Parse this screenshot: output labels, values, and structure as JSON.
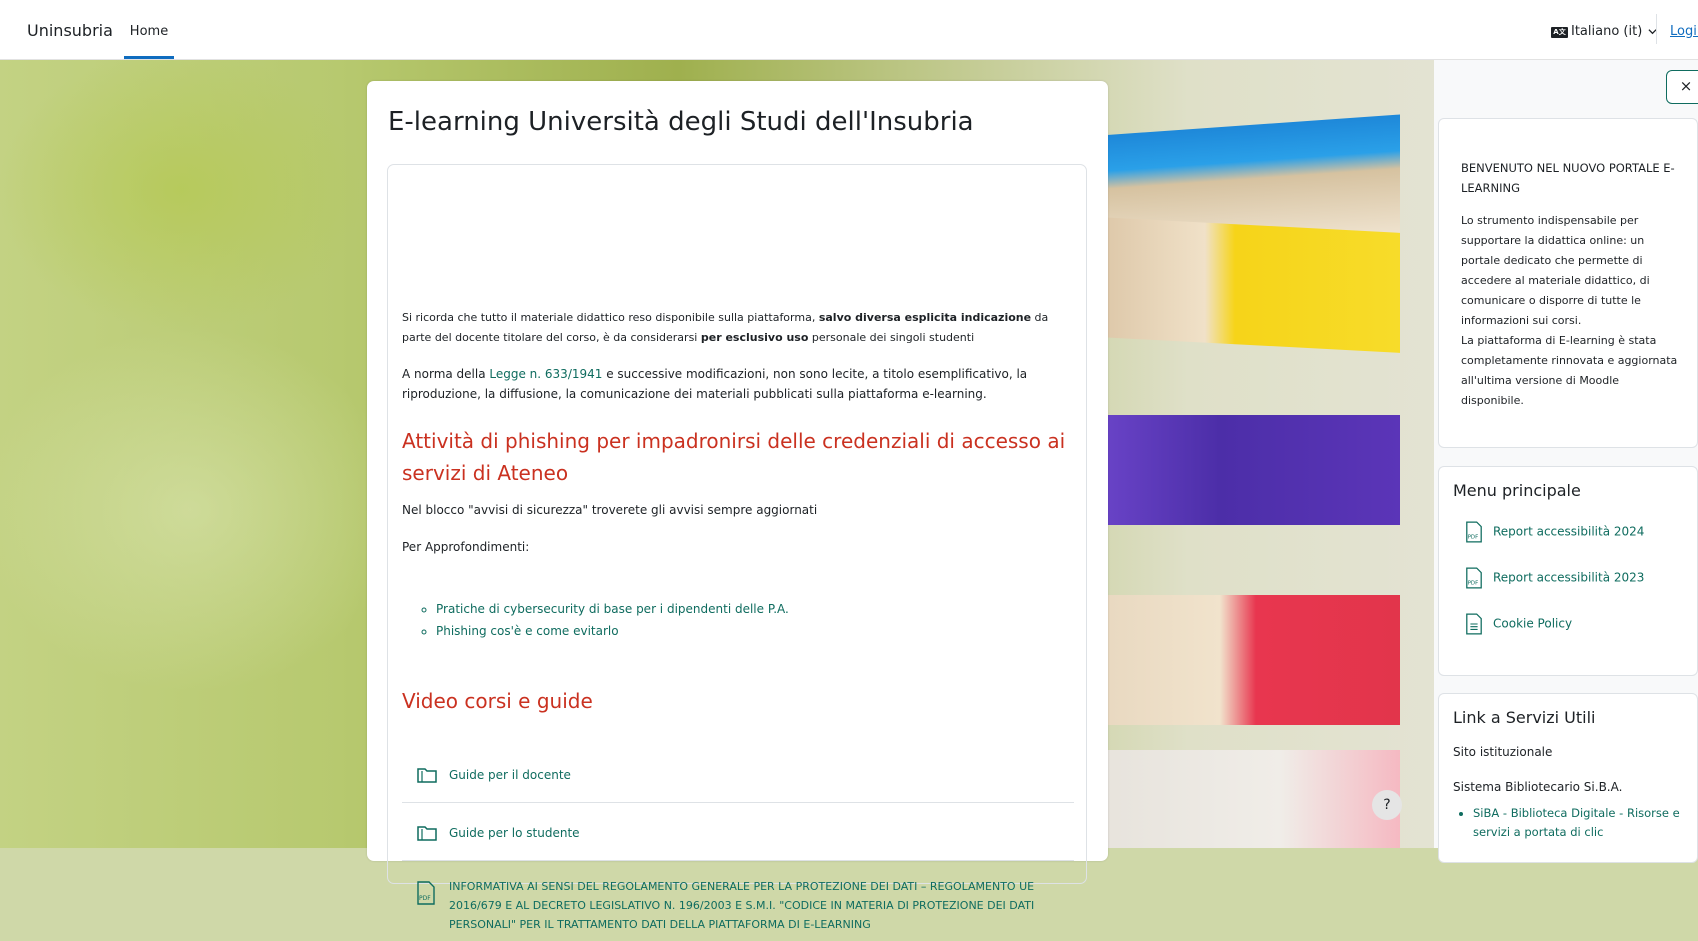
{
  "navbar": {
    "brand": "Uninsubria",
    "home": "Home",
    "language": "Italiano (it)",
    "language_badge": "A文",
    "login": "Login"
  },
  "main": {
    "title": "E-learning Università degli Studi dell'Insubria",
    "p1_a": "Si ricorda che tutto il materiale didattico reso disponibile sulla piattaforma, ",
    "p1_b": "salvo diversa esplicita indicazione",
    "p1_c": " da parte del docente titolare del corso, è da considerarsi ",
    "p1_d": "per esclusivo uso",
    "p1_e": " personale dei singoli studenti",
    "p2_a": "A norma della ",
    "p2_link": "Legge n. 633/1941",
    "p2_b": " e successive modificazioni, non sono lecite, a titolo esemplificativo, la riproduzione, la diffusione, la comunicazione dei materiali pubblicati sulla piattaforma e-learning.",
    "phishing_heading": "Attività di phishing per impadronirsi delle credenziali di accesso ai servizi di Ateneo",
    "p3": "Nel blocco \"avvisi di sicurezza\" troverete gli avvisi sempre aggiornati",
    "p4": "Per Approfondimenti:",
    "links": [
      "Pratiche di cybersecurity di base per i dipendenti delle P.A.",
      "Phishing cos'è e come evitarlo"
    ],
    "video_heading": "Video corsi e guide",
    "activities": [
      "Guide per il docente",
      "Guide per lo studente",
      "INFORMATIVA AI SENSI DEL REGOLAMENTO GENERALE PER LA PROTEZIONE DEI DATI – REGOLAMENTO UE 2016/679 E AL DECRETO LEGISLATIVO N. 196/2003 E S.M.I. \"CODICE IN MATERIA DI PROTEZIONE DEI DATI PERSONALI\" PER IL TRATTAMENTO DATI DELLA PIATTAFORMA DI E-LEARNING"
    ]
  },
  "drawer": {
    "close": "×",
    "welcome_title": "BENVENUTO NEL NUOVO PORTALE E-LEARNING",
    "welcome_text": "Lo strumento indispensabile per supportare la didattica online: un portale dedicato che permette di accedere al materiale didattico, di comunicare o disporre di tutte le informazioni sui corsi.",
    "welcome_text2": "La piattaforma di E-learning è stata completamente rinnovata e aggiornata all'ultima versione di Moodle disponibile.",
    "menu_title": "Menu principale",
    "menu_items": [
      "Report accessibilità 2024",
      "Report accessibilità 2023",
      "Cookie Policy"
    ],
    "services_title": "Link a Servizi Utili",
    "services_link": "Sito istituzionale",
    "services_text": "Sistema Bibliotecario Si.B.A.",
    "services_bullet": "SiBA - Biblioteca Digitale - Risorse e servizi a portata di clic"
  },
  "help": "?",
  "colors": {
    "link": "#0f6c5f",
    "heading_red": "#ca3120",
    "accent": "#0f6cbf"
  }
}
